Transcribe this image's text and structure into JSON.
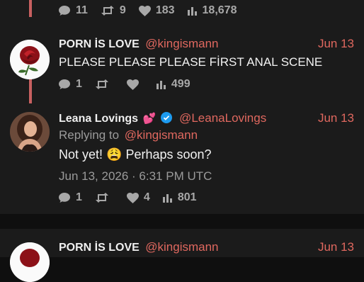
{
  "top_stats": {
    "replies": "11",
    "retweets": "9",
    "likes": "183",
    "views": "18,678"
  },
  "tweet1": {
    "name": "PORN İS LOVE",
    "handle": "@kingismann",
    "date": "Jun 13",
    "text": "PLEASE PLEASE PLEASE FİRST ANAL SCENE",
    "stats": {
      "replies": "1",
      "retweets": "",
      "likes": "",
      "views": "499"
    }
  },
  "tweet2": {
    "name": "Leana Lovings",
    "emoji": "💕",
    "handle": "@LeanaLovings",
    "date": "Jun 13",
    "replying_prefix": "Replying to",
    "replying_to": "@kingismann",
    "text_before": "Not yet!",
    "emoji_mid": "😩",
    "text_after": "Perhaps soon?",
    "timestamp": "Jun 13, 2026 · 6:31 PM UTC",
    "stats": {
      "replies": "1",
      "retweets": "",
      "likes": "4",
      "views": "801"
    }
  },
  "tweet3": {
    "name": "PORN İS LOVE",
    "handle": "@kingismann",
    "date": "Jun 13"
  },
  "colors": {
    "accent": "#e0685f",
    "thread": "#c86060",
    "panel": "#1b1b1b",
    "background": "#0f0f0f"
  }
}
